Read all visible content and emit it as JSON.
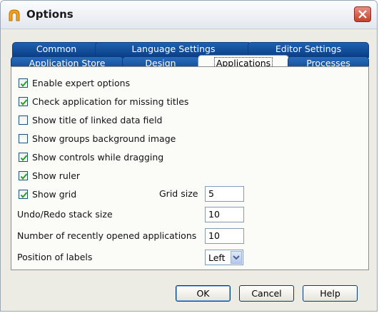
{
  "window": {
    "title": "Options",
    "app_icon": "arch-icon",
    "close_icon": "close-icon"
  },
  "tabs": {
    "row1": [
      "Common",
      "Language Settings",
      "Editor Settings"
    ],
    "row2": [
      "Application Store",
      "Design",
      "Applications",
      "Processes"
    ],
    "active": "Applications"
  },
  "options": [
    {
      "label": "Enable expert options",
      "checked": true
    },
    {
      "label": "Check application for missing titles",
      "checked": true
    },
    {
      "label": "Show title of linked data field",
      "checked": false
    },
    {
      "label": "Show groups background image",
      "checked": false
    },
    {
      "label": "Show controls while dragging",
      "checked": true
    },
    {
      "label": "Show ruler",
      "checked": true
    },
    {
      "label": "Show grid",
      "checked": true
    }
  ],
  "grid_size": {
    "label": "Grid size",
    "value": "5"
  },
  "undo_stack": {
    "label": "Undo/Redo stack size",
    "value": "10"
  },
  "recent_apps": {
    "label": "Number of recently opened applications",
    "value": "10"
  },
  "label_position": {
    "label": "Position of labels",
    "value": "Left"
  },
  "buttons": {
    "ok": "OK",
    "cancel": "Cancel",
    "help": "Help"
  }
}
